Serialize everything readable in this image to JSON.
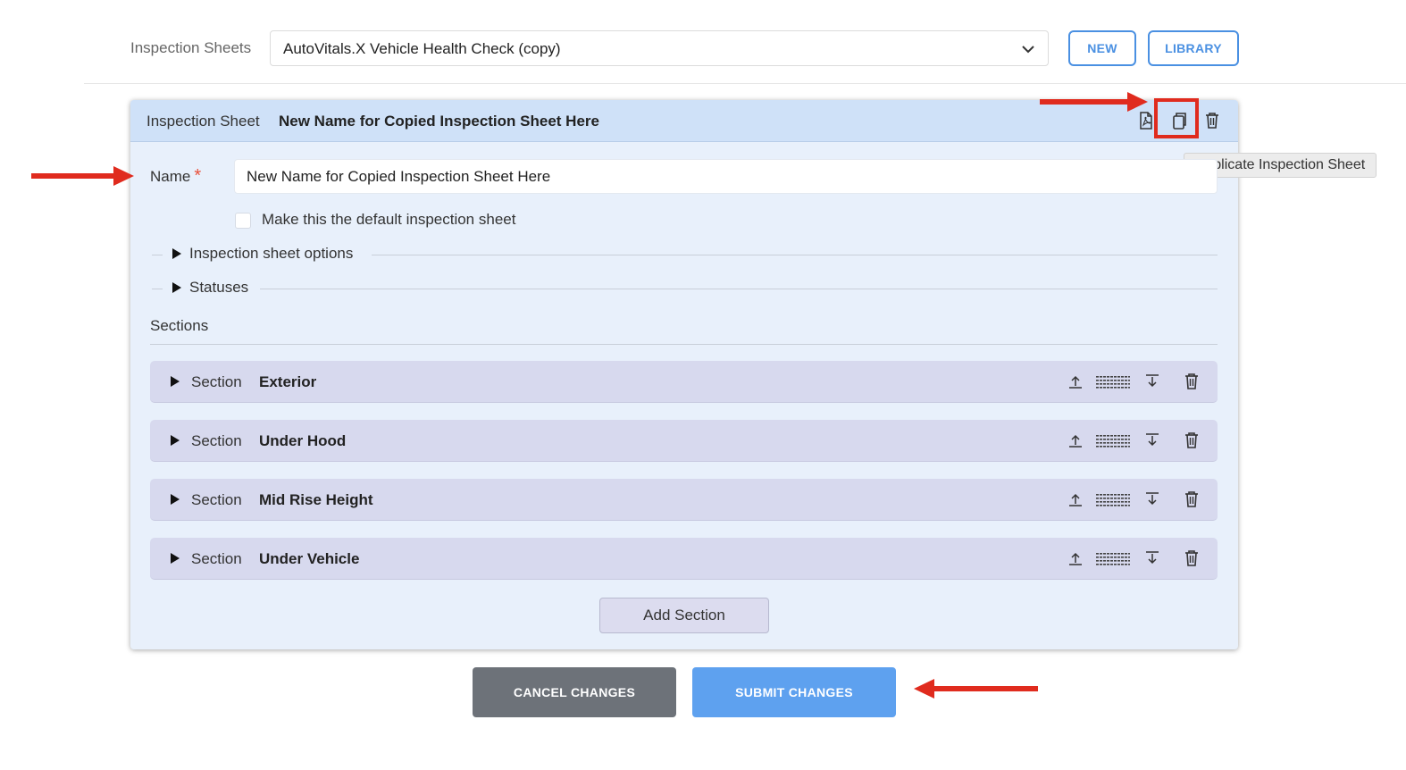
{
  "top": {
    "label": "Inspection Sheets",
    "selected_sheet": "AutoVitals.X Vehicle Health Check (copy)",
    "new_label": "NEW",
    "library_label": "LIBRARY"
  },
  "panel": {
    "header_label": "Inspection Sheet",
    "header_title": "New Name for Copied Inspection Sheet Here",
    "icons": [
      "pdf-icon",
      "duplicate-icon",
      "trash-icon"
    ],
    "tooltip": "Duplicate Inspection Sheet",
    "name_label": "Name",
    "required_mark": "*",
    "name_value": "New Name for Copied Inspection Sheet Here",
    "default_checkbox_label": "Make this the default inspection sheet",
    "default_checked": false,
    "options_label": "Inspection sheet options",
    "statuses_label": "Statuses",
    "sections_label": "Sections",
    "section_prefix": "Section",
    "sections": [
      {
        "name": "Exterior"
      },
      {
        "name": "Under Hood"
      },
      {
        "name": "Mid Rise Height"
      },
      {
        "name": "Under Vehicle"
      }
    ],
    "section_icons": [
      "move-to-top-icon",
      "drag-handle-icon",
      "move-to-bottom-icon",
      "trash-icon"
    ],
    "add_section_label": "Add Section"
  },
  "footer": {
    "cancel_label": "CANCEL CHANGES",
    "submit_label": "SUBMIT CHANGES"
  },
  "colors": {
    "accent": "#4a90e2",
    "annotation_red": "#e02b1e",
    "panel_bg": "#e8f0fb",
    "header_bg": "#cfe1f8",
    "section_bg": "#d7d9ee",
    "submit": "#5ea1ef",
    "cancel": "#6d7279"
  }
}
